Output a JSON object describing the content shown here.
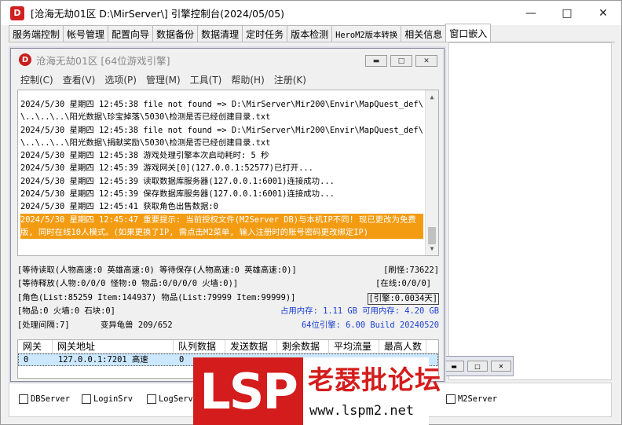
{
  "window": {
    "title": "[沧海无劫01区 D:\\MirServer\\] 引擎控制台(2024/05/05)",
    "icon_letter": "",
    "controls": [
      "minimize-icon",
      "maximize-icon",
      "close-icon"
    ]
  },
  "tabs": [
    {
      "label": "服务端控制"
    },
    {
      "label": "帐号管理"
    },
    {
      "label": "配置向导"
    },
    {
      "label": "数据备份"
    },
    {
      "label": "数据清理"
    },
    {
      "label": "定时任务"
    },
    {
      "label": "版本检测"
    },
    {
      "label": "HeroM2版本转换"
    },
    {
      "label": "相关信息"
    },
    {
      "label": "窗口嵌入"
    }
  ],
  "active_tab": "窗口嵌入",
  "inner_window": {
    "title": "沧海无劫01区 [64位游戏引擎]",
    "menu": [
      "控制(C)",
      "查看(V)",
      "选项(P)",
      "管理(M)",
      "工具(T)",
      "帮助(H)",
      "注册(K)"
    ]
  },
  "log": {
    "lines": [
      "2024/5/30 星期四 12:45:38 file not found => D:\\MirServer\\Mir200\\Envir\\MapQuest_def\\..",
      "\\..\\..\\..\\阳光数据\\珍宝掉落\\5030\\检测是否已经创建目录.txt",
      "2024/5/30 星期四 12:45:38 file not found => D:\\MirServer\\Mir200\\Envir\\MapQuest_def\\..",
      "\\..\\..\\..\\阳光数据\\捐献奖励\\5030\\检测是否已经创建目录.txt",
      "2024/5/30 星期四 12:45:38 游戏处理引擎本次启动耗时: 5 秒",
      "2024/5/30 星期四 12:45:39 游戏网关[0](127.0.0.1:52577)已打开...",
      "2024/5/30 星期四 12:45:39 读取数据库服务器(127.0.0.1:6001)连接成功...",
      "2024/5/30 星期四 12:45:39 保存数据库服务器(127.0.0.1:6001)连接成功...",
      "2024/5/30 星期四 12:45:41 获取角色出售数据:0"
    ],
    "highlight": "2024/5/30 星期四 12:45:47 重要提示: 当前授权文件(M2Server DB)与本机IP不同! 现已更改为免费版, 同时在线10人模式。(如果更换了IP, 需点击M2菜单, 输入注册时的账号密码更改绑定IP)",
    "highlight_color": "#f39c12"
  },
  "stats": {
    "row1_left": "[等待读取(人物高速:0 英雄高速:0) 等待保存(人物高速:0 英雄高速:0)]",
    "row1_right": "[刷怪:73622]",
    "row2_left": "[等待释放(人物:0/0/0 怪物:0 物品:0/0/0/0 火墙:0)]",
    "row2_right": "[在线:0/0/0]",
    "row3_left": "[角色(List:85259 Item:144937) 物品(List:79999 Item:99999)]",
    "row3_right": "[引擎:0.0034天]",
    "row4_left": "[物品:0 火墙:0 石块:0]",
    "row4_right": "占用内存: 1.11 GB 可用内存: 4.20 GB",
    "row5_left": "[处理间隔:7]",
    "row5_mid": "变异龟兽 209/652",
    "row5_right": "64位引擎: 6.00 Build 20240520"
  },
  "gateway_table": {
    "headers": [
      "网关",
      "网关地址",
      "队列数据",
      "发送数据",
      "剩余数据",
      "平均流量",
      "最高人数"
    ],
    "rows": [
      [
        "0",
        "127.0.0.1:7201 高速",
        "0",
        "",
        "",
        "",
        ""
      ]
    ]
  },
  "checkboxes": [
    "DBServer",
    "LoginSrv",
    "LogServer",
    "M2Server"
  ],
  "watermark": {
    "logo": "LSP",
    "name": "老瑟批论坛",
    "url": "www.lspm2.net",
    "color": "#d41c1c"
  }
}
